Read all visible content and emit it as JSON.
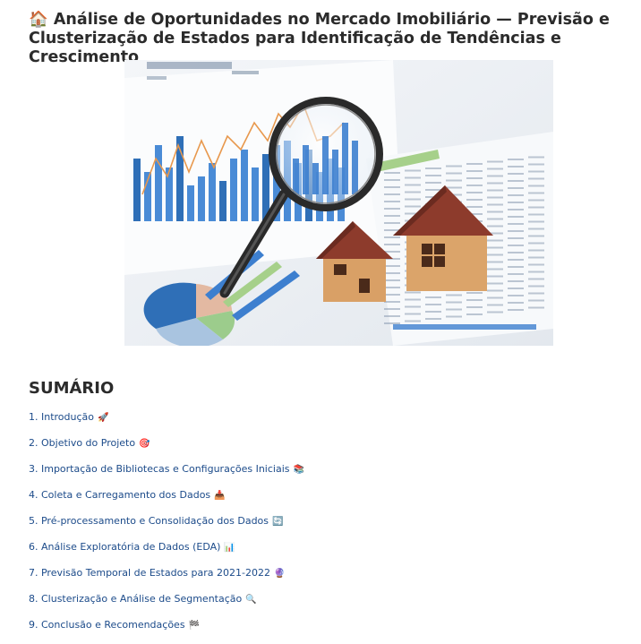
{
  "header": {
    "title_icon": "house-icon",
    "title_emoji": "🏠",
    "title": "Análise de Oportunidades no Mercado Imobiliário — Previsão e Clusterização de Estados para Identificação de Tendências e Crescimento"
  },
  "hero_image": {
    "description_icon": "real-estate-analysis-illustration"
  },
  "toc": {
    "heading": "SUMÁRIO",
    "items": [
      {
        "label": "1. Introdução",
        "emoji": "🚀"
      },
      {
        "label": "2. Objetivo do Projeto",
        "emoji": "🎯"
      },
      {
        "label": "3. Importação de Bibliotecas e Configurações Iniciais",
        "emoji": "📚"
      },
      {
        "label": "4. Coleta e Carregamento dos Dados",
        "emoji": "📥"
      },
      {
        "label": "5. Pré-processamento e Consolidação dos Dados",
        "emoji": "🔄"
      },
      {
        "label": "6. Análise Exploratória de Dados (EDA)",
        "emoji": "📊"
      },
      {
        "label": "7. Previsão Temporal de Estados para 2021-2022",
        "emoji": "🔮"
      },
      {
        "label": "8. Clusterização e Análise de Segmentação",
        "emoji": "🔍"
      },
      {
        "label": "9. Conclusão e Recomendações",
        "emoji": "🏁"
      }
    ]
  },
  "colors": {
    "link": "#1c4b8a",
    "bar_blue": "#3d7fcf",
    "line_orange": "#e8984d",
    "house_wood": "#d9a066",
    "roof_red": "#8d3b2c"
  }
}
